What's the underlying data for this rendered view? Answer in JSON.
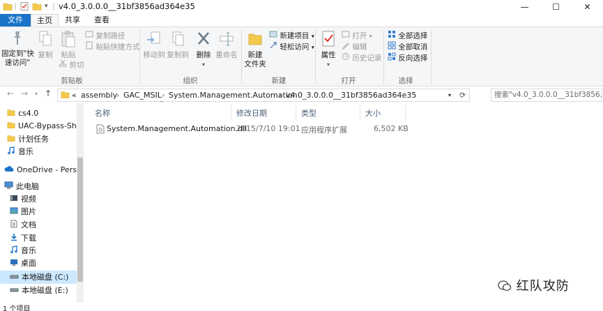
{
  "window": {
    "title": "v4.0_3.0.0.0__31bf3856ad364e35",
    "controls": {
      "minimize": "—",
      "maximize": "☐",
      "close": "✕"
    }
  },
  "tabs": [
    {
      "label": "文件"
    },
    {
      "label": "主页"
    },
    {
      "label": "共享"
    },
    {
      "label": "查看"
    }
  ],
  "ribbon": {
    "clipboard": {
      "pin": "固定到\"快\n速访问\"",
      "copy": "复制",
      "paste": "粘贴",
      "copy_path": "复制路径",
      "paste_shortcut": "粘贴快捷方式",
      "cut": "剪切",
      "label": "剪贴板"
    },
    "organize": {
      "move_to": "移动到",
      "copy_to": "复制到",
      "delete": "删除",
      "rename": "重命名",
      "label": "组织"
    },
    "new": {
      "new_folder": "新建\n文件夹",
      "new_item": "新建项目",
      "easy_access": "轻松访问",
      "label": "新建"
    },
    "open": {
      "properties": "属性",
      "open": "打开",
      "edit": "编辑",
      "history": "历史记录",
      "label": "打开"
    },
    "select": {
      "select_all": "全部选择",
      "select_none": "全部取消",
      "invert": "反向选择",
      "label": "选择"
    }
  },
  "address": {
    "crumbs": [
      "«",
      "assembly",
      "GAC_MSIL",
      "System.Management.Automation",
      "v4.0_3.0.0.0__31bf3856ad364e35"
    ],
    "search_placeholder": "搜索\"v4.0_3.0.0.0__31bf3856..."
  },
  "sidebar": {
    "items": [
      {
        "label": "cs4.0",
        "icon": "folder-icon"
      },
      {
        "label": "UAC-Bypass-Sh",
        "icon": "folder-icon"
      },
      {
        "label": "计划任务",
        "icon": "folder-icon"
      },
      {
        "label": "音乐",
        "icon": "music-icon"
      },
      {
        "label": "OneDrive - Perso",
        "icon": "cloud-icon"
      },
      {
        "label": "此电脑",
        "icon": "computer-icon"
      },
      {
        "label": "视频",
        "icon": "video-icon"
      },
      {
        "label": "图片",
        "icon": "picture-icon"
      },
      {
        "label": "文档",
        "icon": "document-icon"
      },
      {
        "label": "下载",
        "icon": "download-icon"
      },
      {
        "label": "音乐",
        "icon": "music-icon"
      },
      {
        "label": "桌面",
        "icon": "desktop-icon"
      },
      {
        "label": "本地磁盘 (C:)",
        "icon": "drive-icon"
      },
      {
        "label": "本地磁盘 (E:)",
        "icon": "drive-icon"
      }
    ]
  },
  "list": {
    "columns": [
      "名称",
      "修改日期",
      "类型",
      "大小"
    ],
    "rows": [
      {
        "name": "System.Management.Automation.dll",
        "modified": "2015/7/10 19:01",
        "type": "应用程序扩展",
        "size": "6,502 KB"
      }
    ]
  },
  "status": {
    "text": "1 个项目"
  },
  "watermark": {
    "text": "红队攻防"
  },
  "colors": {
    "accent": "#1a73c8",
    "selected": "#cce8ff",
    "ribbon_bg": "#f5f6f7"
  }
}
